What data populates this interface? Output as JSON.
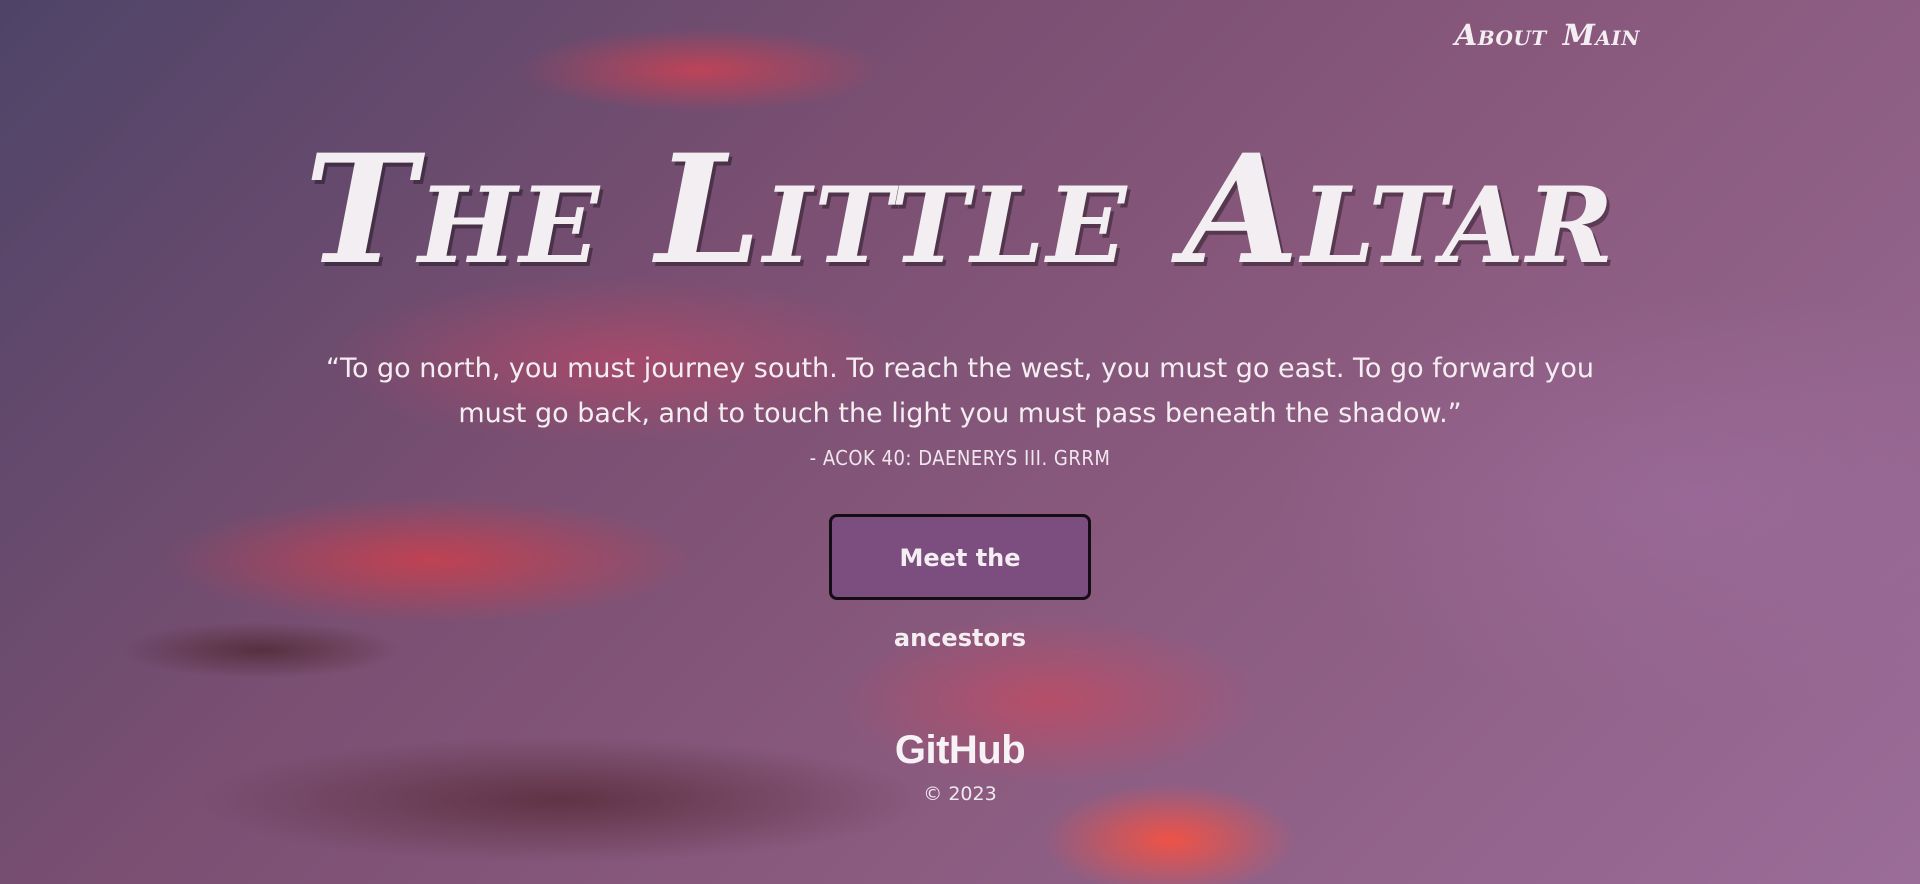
{
  "nav": {
    "items": [
      {
        "label": "About"
      },
      {
        "label": "Main"
      }
    ]
  },
  "hero": {
    "title": "The Little Altar",
    "quote": "“To go north, you must journey south. To reach the west, you must go east. To go forward you must go back, and to touch the light you must pass beneath the shadow.”",
    "attribution": "- ACOK 40: DAENERYS III. GRRM",
    "cta_label": "Meet the ancestors"
  },
  "footer": {
    "github_label": "GitHub",
    "copyright": "© 2023"
  },
  "colors": {
    "text": "#f4eef2",
    "button_bg": "#7c4e80",
    "button_border": "#140d14"
  }
}
